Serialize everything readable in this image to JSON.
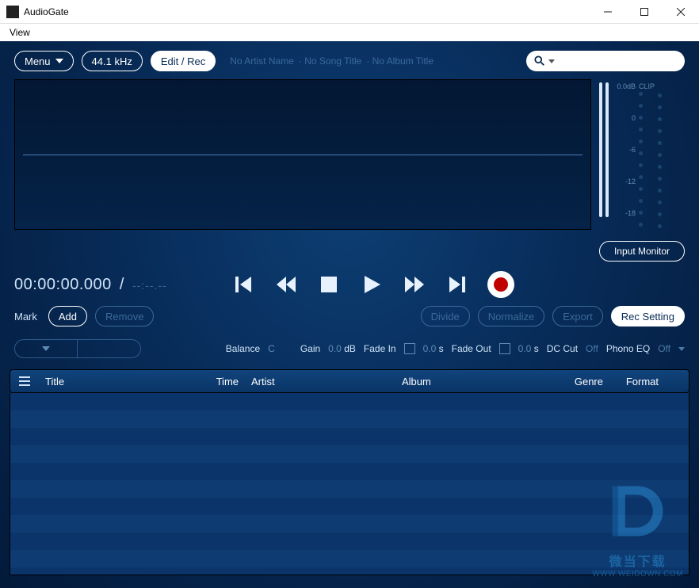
{
  "window": {
    "title": "AudioGate",
    "menu": {
      "view": "View"
    }
  },
  "topbar": {
    "menu_label": "Menu",
    "sample_rate": "44.1 kHz",
    "mode_label": "Edit / Rec",
    "meta_artist": "No Artist Name",
    "meta_song": "No Song Title",
    "meta_album": "No Album Title"
  },
  "meter": {
    "db_label": "0.0dB",
    "clip_label": "CLIP",
    "scale": [
      "0",
      "-6",
      "-12",
      "-18"
    ],
    "input_monitor": "Input Monitor"
  },
  "transport": {
    "time": "00:00:00.000",
    "slash": "/",
    "duration": "--:--.--"
  },
  "mark": {
    "label": "Mark",
    "add": "Add",
    "remove": "Remove",
    "divide": "Divide",
    "normalize": "Normalize",
    "export": "Export",
    "rec_setting": "Rec Setting"
  },
  "controls": {
    "balance_label": "Balance",
    "balance_value": "C",
    "gain_label": "Gain",
    "gain_value": "0.0",
    "gain_unit": "dB",
    "fadein_label": "Fade In",
    "fadein_value": "0.0",
    "fadein_unit": "s",
    "fadeout_label": "Fade Out",
    "fadeout_value": "0.0",
    "fadeout_unit": "s",
    "dccut_label": "DC Cut",
    "dccut_value": "Off",
    "phonoeq_label": "Phono EQ",
    "phonoeq_value": "Off"
  },
  "table": {
    "headers": {
      "title": "Title",
      "time": "Time",
      "artist": "Artist",
      "album": "Album",
      "genre": "Genre",
      "format": "Format"
    }
  },
  "watermark": {
    "text_cn": "微当下载",
    "url": "WWW.WEIDOWN.COM"
  }
}
